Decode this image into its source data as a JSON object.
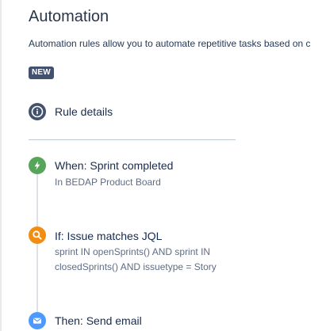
{
  "header": {
    "title": "Automation",
    "description": "Automation rules allow you to automate repetitive tasks based on c",
    "badge": "NEW"
  },
  "rule_details": {
    "label": "Rule details",
    "icon": "info-icon"
  },
  "steps": [
    {
      "icon": "lightning-icon",
      "color": "#57a55a",
      "title": "When: Sprint completed",
      "lines": [
        "In BEDAP Product Board"
      ]
    },
    {
      "icon": "search-icon",
      "color": "#f18d13",
      "title": "If: Issue matches JQL",
      "lines": [
        "sprint IN openSprints() AND sprint IN",
        "closedSprints() AND issuetype = Story"
      ]
    },
    {
      "icon": "mail-icon",
      "color": "#4c9aff",
      "title": "Then: Send email",
      "lines": []
    }
  ],
  "colors": {
    "badge_bg": "#42526e",
    "info": "#42526e",
    "text": "#172b4d",
    "muted": "#5e6c84"
  }
}
